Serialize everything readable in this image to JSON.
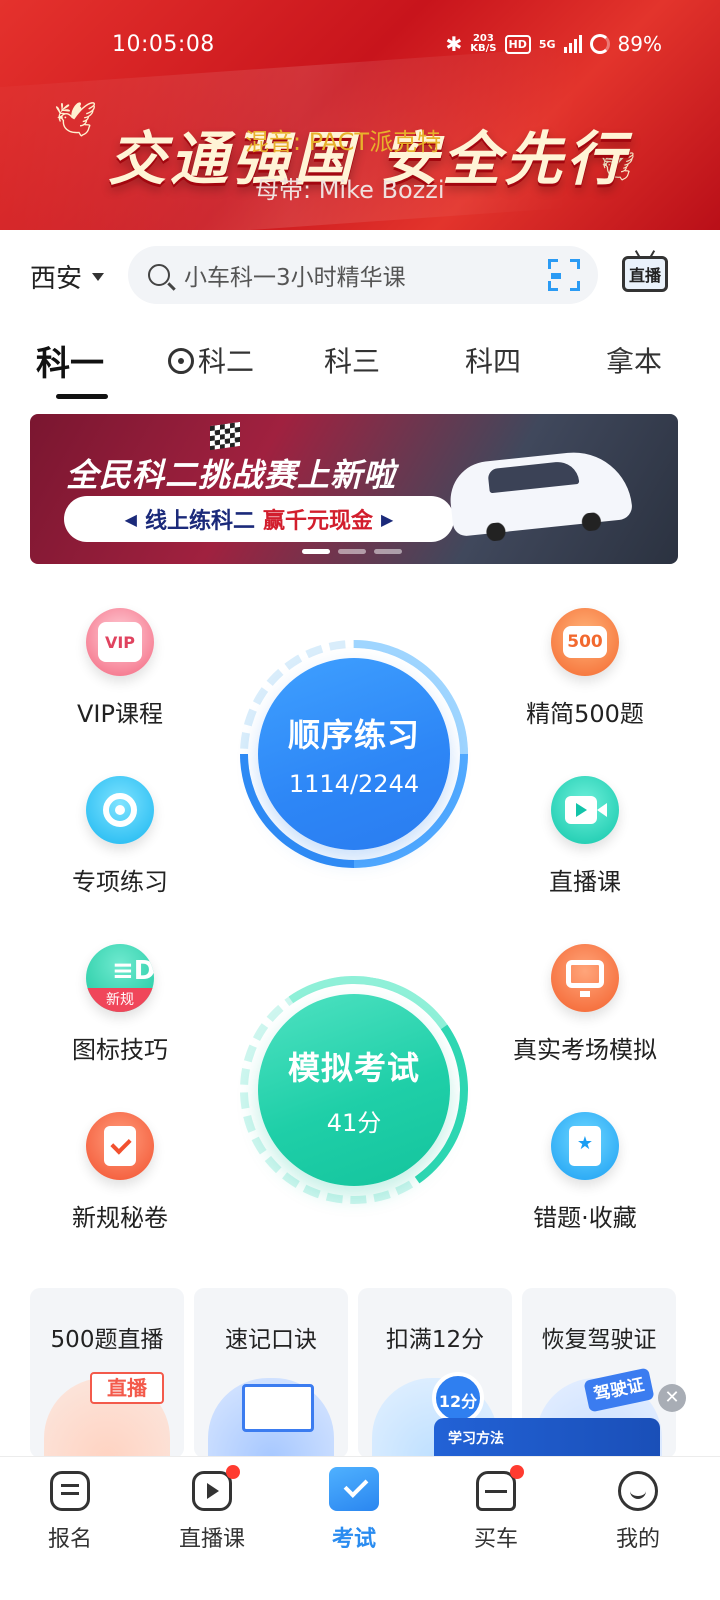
{
  "status_bar": {
    "time": "10:05:08",
    "net_speed_value": "203",
    "net_speed_unit": "KB/S",
    "hd": "HD",
    "network": "5G",
    "battery": "89%"
  },
  "hero": {
    "slogan": "交通强国 安全先行",
    "credit_line1": "混音: PACT派克特",
    "credit_line2": "母带: Mike Bozzi"
  },
  "search": {
    "city": "西安",
    "placeholder": "小车科一3小时精华课",
    "live_label": "直播"
  },
  "tabs": [
    {
      "label": "科一",
      "active": true
    },
    {
      "label": "科二",
      "active": false
    },
    {
      "label": "科三",
      "active": false
    },
    {
      "label": "科四",
      "active": false
    },
    {
      "label": "拿本",
      "active": false
    }
  ],
  "promo": {
    "title": "全民科二挑战赛上新啦",
    "pill_left": "线上练科二",
    "pill_right": "赢千元现金",
    "current_slide": 1,
    "slide_count": 3
  },
  "features": {
    "vip": {
      "label": "VIP课程",
      "icon_text": "VIP"
    },
    "select500": {
      "label": "精简500题",
      "icon_text": "500"
    },
    "special": {
      "label": "专项练习"
    },
    "live": {
      "label": "直播课"
    },
    "signs": {
      "label": "图标技巧",
      "icon_text": "新规"
    },
    "real_exam": {
      "label": "真实考场模拟"
    },
    "secret": {
      "label": "新规秘卷"
    },
    "wrong": {
      "label": "错题·收藏"
    }
  },
  "practice": {
    "title": "顺序练习",
    "progress": "1114/2244",
    "done": 1114,
    "total": 2244
  },
  "mock_exam": {
    "title": "模拟考试",
    "score": "41分"
  },
  "cards": [
    {
      "title": "500题直播",
      "badge": "直播"
    },
    {
      "title": "速记口诀"
    },
    {
      "title": "扣满12分",
      "badge": "12分"
    },
    {
      "title": "恢复驾驶证",
      "badge": "驾驶证"
    }
  ],
  "floating_video": {
    "title": "学习方法"
  },
  "bottom_nav": [
    {
      "label": "报名",
      "badge": false,
      "active": false
    },
    {
      "label": "直播课",
      "badge": true,
      "active": false
    },
    {
      "label": "考试",
      "badge": false,
      "active": true
    },
    {
      "label": "买车",
      "badge": true,
      "active": false
    },
    {
      "label": "我的",
      "badge": false,
      "active": false
    }
  ],
  "colors": {
    "accent_blue": "#2a8cf0",
    "accent_green": "#14c49d",
    "hero_red": "#d0191f",
    "badge_red": "#ff3b30"
  }
}
